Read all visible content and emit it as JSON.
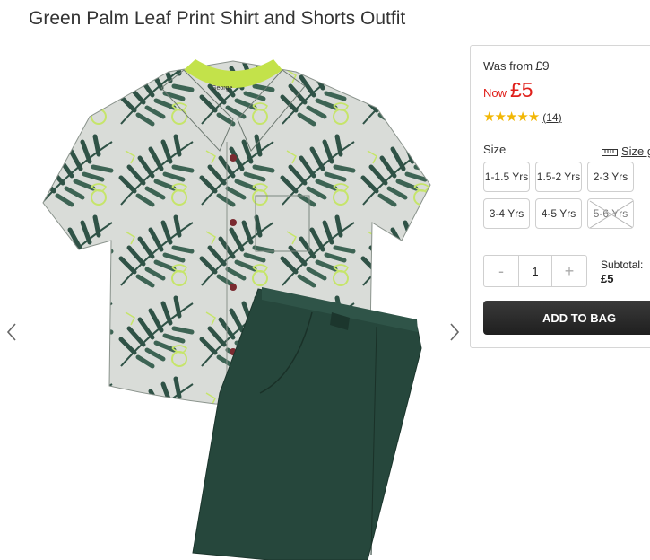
{
  "product": {
    "title": "Green Palm Leaf Print Shirt and Shorts Outfit"
  },
  "gallery": {
    "prev_icon": "chevron-left-icon",
    "next_icon": "chevron-right-icon",
    "image": "shirt-and-shorts-image"
  },
  "pricing": {
    "was_label": "Was from",
    "was_price": "£9",
    "now_label": "Now",
    "now_price": "£5",
    "sale_color": "#e0201b"
  },
  "rating": {
    "stars": 5,
    "max": 5,
    "count": "14",
    "star_color": "#f2b705"
  },
  "size": {
    "label": "Size",
    "guide_label": "Size g",
    "options": [
      {
        "label": "1-1.5 Yrs",
        "available": true
      },
      {
        "label": "1.5-2 Yrs",
        "available": true
      },
      {
        "label": "2-3 Yrs",
        "available": true
      },
      {
        "label": "3-4 Yrs",
        "available": true
      },
      {
        "label": "4-5 Yrs",
        "available": true
      },
      {
        "label": "5-6 Yrs",
        "available": false
      }
    ]
  },
  "quantity": {
    "minus": "-",
    "value": "1",
    "plus": "+"
  },
  "subtotal": {
    "label": "Subtotal:",
    "amount": "£5"
  },
  "cart": {
    "add_label": "ADD TO BAG"
  }
}
